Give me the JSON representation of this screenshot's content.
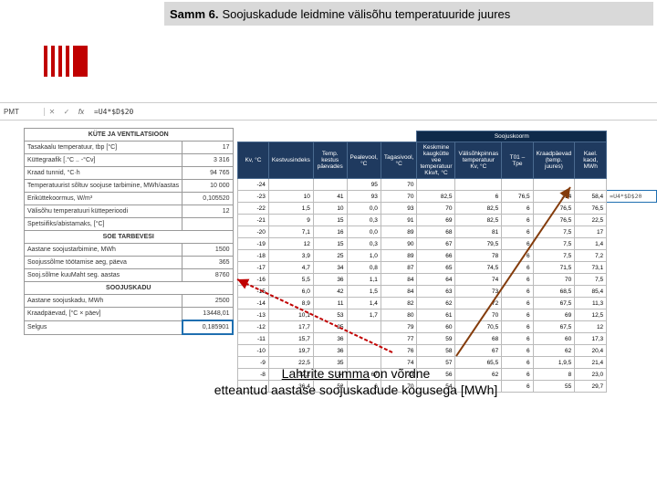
{
  "title": {
    "strong": "Samm 6.",
    "rest": "Soojuskadude leidmine välisõhu temperatuuride juures"
  },
  "formulaBar": {
    "cell": "PMT",
    "fx": "fx",
    "formula": "=U4*$D$20"
  },
  "leftSections": {
    "s1": "KÜTE JA VENTILATSIOON",
    "r1l": "Tasakaalu temperatuur, tbp [°C]",
    "r1v": "17",
    "r2l": "Küttegraafik [.°C .. -°Cv]",
    "r2v": "3 316",
    "r3l": "Kraad tunnid, °C·h",
    "r3v": "94 765",
    "r4l": "Temperatuurist sõltuv soojuse tarbimine,\nMWh/aastas",
    "r4v": "10 000",
    "r5l": "Eriküttekoormus, W/m³",
    "r5v": "0,105520",
    "r6l": "Välisõhu temperatuuri kütteperioodi",
    "r6v": "12",
    "r7l": "Spetsiifiks/abistamaks, [°C]",
    "r7v": "",
    "s2": "SOE TARBEVESI",
    "r8l": "Aastane soojustarbimine, MWh",
    "r8v": "1500",
    "r9l": "Soojussõlme töötamise aeg, päeva",
    "r9v": "365",
    "r10l": "Sooj.sõlme kuuMaht seg. aastas",
    "r10v": "8760",
    "s3": "SOOJUSKADU",
    "r11l": "Aastane soojuskadu, MWh",
    "r11v": "2500",
    "r12l": "Kraadpäevad, [°C × päev]",
    "r12v": "13448,01",
    "r13l": "Selgus",
    "r13v": "0,185901"
  },
  "rightHeaders": {
    "super": "Soojuskoorm",
    "h1": "Kv, °C",
    "h2": "Kestvusindeks",
    "h3": "Temp. kestus päevades",
    "h4": "Pealevool, °C",
    "h5": "Tagasivool, °C",
    "h6": "Keskmine kaugkütte vee temperatuur Kkv/t, °C",
    "h7": "Välisõhkpinnas temperatuur Kv, °C",
    "h8": "T01 – Tpe",
    "h9": "Kraadpäevad (temp. juures)",
    "h10": "Kael. kaod, MWh"
  },
  "rows": [
    {
      "a": "-24",
      "b": "",
      "c": "",
      "d": "95",
      "e": "70",
      "f": "",
      "g": "",
      "h": "",
      "i": "",
      "j": ""
    },
    {
      "a": "-23",
      "b": "10",
      "c": "41",
      "d": "93",
      "e": "70",
      "f": "82,5",
      "g": "6",
      "h": "76,5",
      "i": "314",
      "j": "58,4",
      "k": "=U4*$D$20"
    },
    {
      "a": "-22",
      "b": "1,5",
      "c": "10",
      "d": "0,0",
      "e": "93",
      "f": "70",
      "g": "82,5",
      "h": "6",
      "i": "76,5",
      "j": "76,5"
    },
    {
      "a": "-21",
      "b": "9",
      "c": "15",
      "d": "0,3",
      "e": "91",
      "f": "69",
      "g": "82,5",
      "h": "6",
      "i": "76,5",
      "j": "22,5"
    },
    {
      "a": "-20",
      "b": "7,1",
      "c": "16",
      "d": "0,0",
      "e": "89",
      "f": "68",
      "g": "81",
      "h": "6",
      "i": "7,5",
      "j": "17"
    },
    {
      "a": "-19",
      "b": "12",
      "c": "15",
      "d": "0,3",
      "e": "90",
      "f": "67",
      "g": "79,5",
      "h": "6",
      "i": "7,5",
      "j": "1,4"
    },
    {
      "a": "-18",
      "b": "3,9",
      "c": "25",
      "d": "1,0",
      "e": "89",
      "f": "66",
      "g": "78",
      "h": "6",
      "i": "7,5",
      "j": "7,2"
    },
    {
      "a": "-17",
      "b": "4,7",
      "c": "34",
      "d": "0,8",
      "e": "87",
      "f": "65",
      "g": "74,5",
      "h": "6",
      "i": "71,5",
      "j": "73,1"
    },
    {
      "a": "-16",
      "b": "5,5",
      "c": "36",
      "d": "1,1",
      "e": "84",
      "f": "64",
      "g": "74",
      "h": "6",
      "i": "70",
      "j": "7,5"
    },
    {
      "a": "-15",
      "b": "6,0",
      "c": "42",
      "d": "1,5",
      "e": "84",
      "f": "63",
      "g": "73",
      "h": "6",
      "i": "68,5",
      "j": "85,4"
    },
    {
      "a": "-14",
      "b": "8,9",
      "c": "11",
      "d": "1,4",
      "e": "82",
      "f": "62",
      "g": "72",
      "h": "6",
      "i": "67,5",
      "j": "11,3"
    },
    {
      "a": "-13",
      "b": "10,1",
      "c": "53",
      "d": "1,7",
      "e": "80",
      "f": "61",
      "g": "70",
      "h": "6",
      "i": "69",
      "j": "12,5"
    },
    {
      "a": "-12",
      "b": "17,7",
      "c": "25",
      "d": "",
      "e": "79",
      "f": "60",
      "g": "70,5",
      "h": "6",
      "i": "67,5",
      "j": "12"
    },
    {
      "a": "-11",
      "b": "15,7",
      "c": "36",
      "d": "",
      "e": "77",
      "f": "59",
      "g": "68",
      "h": "6",
      "i": "60",
      "j": "17,3"
    },
    {
      "a": "-10",
      "b": "19,7",
      "c": "36",
      "d": "",
      "e": "76",
      "f": "58",
      "g": "67",
      "h": "6",
      "i": "62",
      "j": "20,4"
    },
    {
      "a": "-9",
      "b": "22,5",
      "c": "35",
      "d": "",
      "e": "74",
      "f": "57",
      "g": "65,5",
      "h": "6",
      "i": "1,9,5",
      "j": "21,4"
    },
    {
      "a": "-8",
      "b": "32,2",
      "c": "74",
      "d": "67",
      "e": "73",
      "f": "56",
      "g": "62",
      "h": "6",
      "i": "8",
      "j": "23,0"
    },
    {
      "a": "",
      "b": "36,4",
      "c": "52",
      "d": "6",
      "e": "70",
      "f": "54",
      "g": "",
      "h": "6",
      "i": "55",
      "j": "29,7"
    }
  ],
  "caption": {
    "l1a": "Lahtrite summa",
    "l1b": "on võrdne",
    "l2": "etteantud aastase soojuskadude kogusega [MWh]"
  }
}
